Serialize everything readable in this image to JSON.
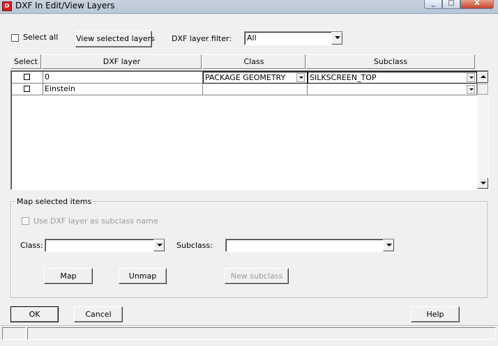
{
  "window": {
    "title": "DXF In Edit/View Layers",
    "icon_name": "dxf-app-icon",
    "icon_glyph": "D",
    "minimize_glyph": "_",
    "maximize_glyph": "□",
    "close_glyph": "X"
  },
  "toolbar": {
    "select_all_label": "Select all",
    "select_all_checked": false,
    "view_selected_label": "View selected layers",
    "filter_label": "DXF layer filter:",
    "filter_value": "All"
  },
  "grid": {
    "columns": [
      "Select",
      "DXF layer",
      "Class",
      "Subclass"
    ],
    "rows": [
      {
        "selected": false,
        "layer": "0",
        "class": "PACKAGE GEOMETRY",
        "subclass": "SILKSCREEN_TOP"
      },
      {
        "selected": false,
        "layer": "Einstein",
        "class": "",
        "subclass": ""
      }
    ]
  },
  "map_group": {
    "title": "Map selected items",
    "use_layer_label": "Use DXF layer as subclass name",
    "use_layer_checked": false,
    "class_label": "Class:",
    "class_value": "",
    "subclass_label": "Subclass:",
    "subclass_value": "",
    "map_label": "Map",
    "unmap_label": "Unmap",
    "new_subclass_label": "New subclass"
  },
  "footer": {
    "ok_label": "OK",
    "cancel_label": "Cancel",
    "help_label": "Help"
  }
}
